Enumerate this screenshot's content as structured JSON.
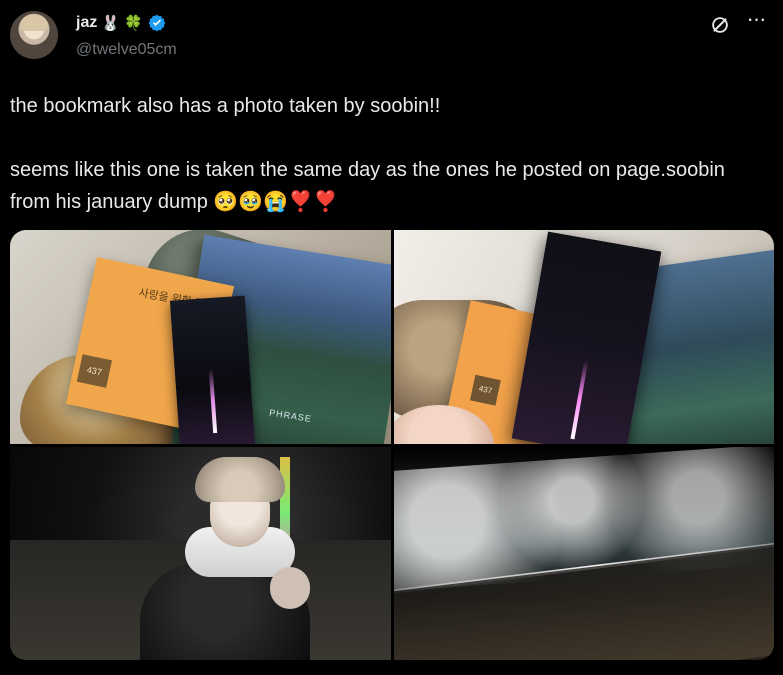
{
  "user": {
    "name": "jaz",
    "name_emojis": [
      "🐰",
      "🍀"
    ],
    "handle": "@twelve05cm",
    "verified": true,
    "verified_color": "#1d9bf0"
  },
  "top_actions": {
    "grok_icon": "slash-circle-icon",
    "more_label": "···"
  },
  "tweet": {
    "text": "the bookmark also has a photo taken by soobin!!\n\nseems like this one is taken the same day as the ones he posted on page.soobin from his january dump 🥺🥹😭❣️❣️"
  },
  "media": {
    "photo1_title": "사랑을 위한 되풀이",
    "photo1_label": "437",
    "photo1_caption": "PHRASE",
    "photo2_label": "437"
  },
  "colors": {
    "background": "#000000",
    "text": "#e7e9ea",
    "muted": "#71767b"
  }
}
